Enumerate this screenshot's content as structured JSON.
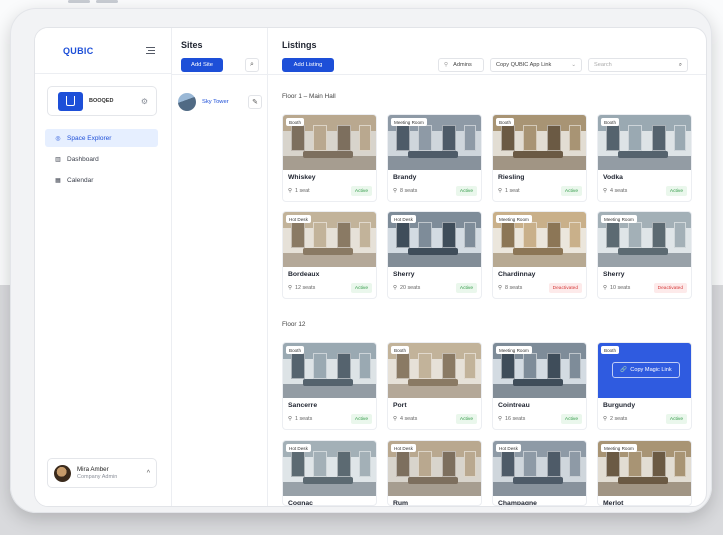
{
  "app": {
    "brand": "QUBIC"
  },
  "org": {
    "name": "BOOQED"
  },
  "nav": {
    "items": [
      {
        "label": "Space Explorer",
        "icon": "compass-icon",
        "glyph": "◎"
      },
      {
        "label": "Dashboard",
        "icon": "bar-chart-icon",
        "glyph": "▥"
      },
      {
        "label": "Calendar",
        "icon": "calendar-icon",
        "glyph": "▦"
      }
    ]
  },
  "user": {
    "name": "Mira Amber",
    "role": "Company Admin"
  },
  "sites": {
    "title": "Sites",
    "add_label": "Add Site",
    "items": [
      {
        "name": "Sky Tower"
      }
    ]
  },
  "listings": {
    "title": "Listings",
    "add_label": "Add Listing",
    "role_filter": "Admins",
    "copy_link_label": "Copy QUBIC App Link",
    "search_placeholder": "Search",
    "floors": [
      {
        "label": "Floor 1 – Main Hall",
        "cards": [
          {
            "tag": "Booth",
            "name": "Whiskey",
            "seats": "1 seat",
            "status": "Active",
            "status_kind": "active"
          },
          {
            "tag": "Meeting Room",
            "name": "Brandy",
            "seats": "8 seats",
            "status": "Active",
            "status_kind": "active"
          },
          {
            "tag": "Booth",
            "name": "Riesling",
            "seats": "1 seat",
            "status": "Active",
            "status_kind": "active"
          },
          {
            "tag": "Booth",
            "name": "Vodka",
            "seats": "4 seats",
            "status": "Active",
            "status_kind": "active"
          },
          {
            "tag": "Hot Desk",
            "name": "Bordeaux",
            "seats": "12 seats",
            "status": "Active",
            "status_kind": "active"
          },
          {
            "tag": "Hot Desk",
            "name": "Sherry",
            "seats": "20 seats",
            "status": "Active",
            "status_kind": "active"
          },
          {
            "tag": "Meeting Room",
            "name": "Chardinnay",
            "seats": "8 seats",
            "status": "Deactivated",
            "status_kind": "deactivated"
          },
          {
            "tag": "Meeting Room",
            "name": "Sherry",
            "seats": "10 seats",
            "status": "Deactivated",
            "status_kind": "deactivated"
          }
        ]
      },
      {
        "label": "Floor 12",
        "cards": [
          {
            "tag": "Booth",
            "name": "Sancerre",
            "seats": "1 seats",
            "status": "Active",
            "status_kind": "active"
          },
          {
            "tag": "Booth",
            "name": "Port",
            "seats": "4 seats",
            "status": "Active",
            "status_kind": "active"
          },
          {
            "tag": "Meeting Room",
            "name": "Cointreau",
            "seats": "16 seats",
            "status": "Active",
            "status_kind": "active"
          },
          {
            "tag": "Booth",
            "name": "Burgundy",
            "seats": "2 seats",
            "status": "Active",
            "status_kind": "active",
            "hover_label": "Copy Magic Link"
          },
          {
            "tag": "Hot Desk",
            "name": "Cognac",
            "seats": "",
            "status": "",
            "status_kind": ""
          },
          {
            "tag": "Hot Desk",
            "name": "Rum",
            "seats": "",
            "status": "",
            "status_kind": ""
          },
          {
            "tag": "Hot Desk",
            "name": "Champagne",
            "seats": "",
            "status": "",
            "status_kind": ""
          },
          {
            "tag": "Meeting Room",
            "name": "Merlot",
            "seats": "",
            "status": "",
            "status_kind": ""
          }
        ]
      }
    ]
  },
  "colors": {
    "accent": "#1d4fd8",
    "active_text": "#2f9a45",
    "deactivated_text": "#d63b3b"
  }
}
